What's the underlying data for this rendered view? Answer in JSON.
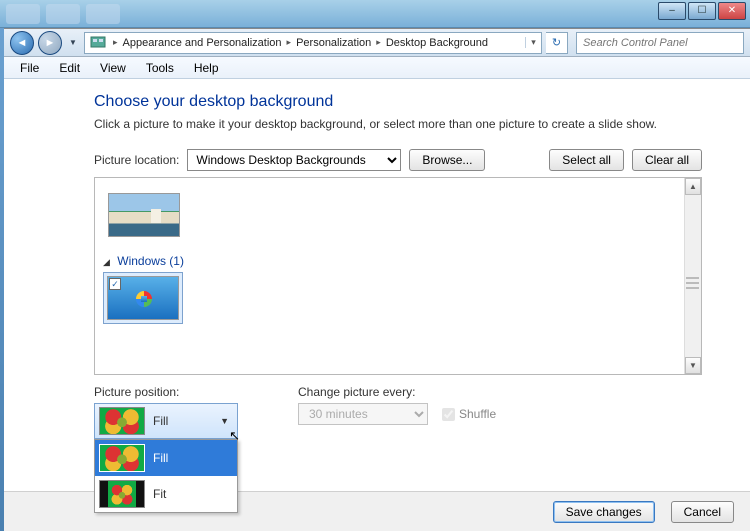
{
  "window_controls": {
    "min": "–",
    "max": "☐",
    "close": "✕"
  },
  "breadcrumb": {
    "root_icon": "control-panel-icon",
    "items": [
      "Appearance and Personalization",
      "Personalization",
      "Desktop Background"
    ]
  },
  "search": {
    "placeholder": "Search Control Panel"
  },
  "menu": {
    "items": [
      "File",
      "Edit",
      "View",
      "Tools",
      "Help"
    ]
  },
  "heading": "Choose your desktop background",
  "subheading": "Click a picture to make it your desktop background, or select more than one picture to create a slide show.",
  "picture_location": {
    "label": "Picture location:",
    "value": "Windows Desktop Backgrounds",
    "browse": "Browse...",
    "select_all": "Select all",
    "clear_all": "Clear all"
  },
  "groups": {
    "windows": {
      "label": "Windows (1)"
    }
  },
  "picture_position": {
    "label": "Picture position:",
    "selected": "Fill",
    "options": [
      "Fill",
      "Fit"
    ]
  },
  "change_every": {
    "label": "Change picture every:",
    "value": "30 minutes",
    "shuffle": "Shuffle"
  },
  "footer": {
    "save": "Save changes",
    "cancel": "Cancel"
  }
}
